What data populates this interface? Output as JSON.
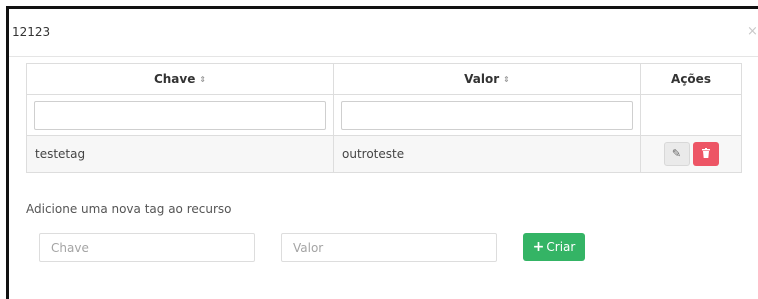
{
  "modal": {
    "title": "12123",
    "close_symbol": "×"
  },
  "table": {
    "columns": [
      {
        "label": "Chave",
        "sort_icon": "⇕"
      },
      {
        "label": "Valor",
        "sort_icon": "⇕"
      },
      {
        "label": "Ações"
      }
    ],
    "rows": [
      {
        "key": "testetag",
        "value": "outroteste"
      }
    ]
  },
  "new_tag": {
    "label": "Adicione uma nova tag ao recurso",
    "key_placeholder": "Chave",
    "value_placeholder": "Valor",
    "create_label": "Criar"
  },
  "colors": {
    "create_button": "#34b465",
    "delete_button": "#ed5565"
  }
}
